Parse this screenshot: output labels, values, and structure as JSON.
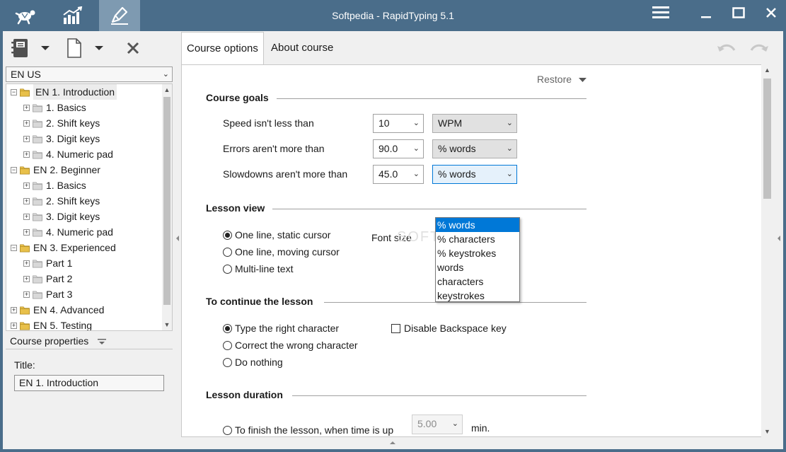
{
  "window": {
    "title": "Softpedia - RapidTyping  5.1"
  },
  "tree": {
    "language": "EN US",
    "items": [
      {
        "label": "EN 1. Introduction",
        "level": 0,
        "exp": "−",
        "selected": true
      },
      {
        "label": "1. Basics",
        "level": 1,
        "exp": "+"
      },
      {
        "label": "2. Shift keys",
        "level": 1,
        "exp": "+"
      },
      {
        "label": "3. Digit keys",
        "level": 1,
        "exp": "+"
      },
      {
        "label": "4. Numeric pad",
        "level": 1,
        "exp": "+"
      },
      {
        "label": "EN 2. Beginner",
        "level": 0,
        "exp": "−"
      },
      {
        "label": "1. Basics",
        "level": 1,
        "exp": "+"
      },
      {
        "label": "2. Shift keys",
        "level": 1,
        "exp": "+"
      },
      {
        "label": "3. Digit keys",
        "level": 1,
        "exp": "+"
      },
      {
        "label": "4. Numeric pad",
        "level": 1,
        "exp": "+"
      },
      {
        "label": "EN 3. Experienced",
        "level": 0,
        "exp": "−"
      },
      {
        "label": "Part 1",
        "level": 1,
        "exp": "+"
      },
      {
        "label": "Part 2",
        "level": 1,
        "exp": "+"
      },
      {
        "label": "Part 3",
        "level": 1,
        "exp": "+"
      },
      {
        "label": "EN 4. Advanced",
        "level": 0,
        "exp": "+"
      },
      {
        "label": "EN 5. Testing",
        "level": 0,
        "exp": "+"
      }
    ]
  },
  "properties": {
    "header": "Course properties",
    "title_label": "Title:",
    "title_value": "EN 1. Introduction"
  },
  "tabs": {
    "course_options": "Course options",
    "about_course": "About course"
  },
  "options": {
    "restore": "Restore",
    "course_goals": {
      "heading": "Course goals",
      "speed_label": "Speed isn't less than",
      "speed_value": "10",
      "speed_unit": "WPM",
      "errors_label": "Errors aren't more than",
      "errors_value": "90.0",
      "errors_unit": "% words",
      "slowdowns_label": "Slowdowns aren't more than",
      "slowdowns_value": "45.0",
      "slowdowns_unit": "% words"
    },
    "unit_options": [
      "% words",
      "% characters",
      "% keystrokes",
      "words",
      "characters",
      "keystrokes"
    ],
    "lesson_view": {
      "heading": "Lesson view",
      "opt1": "One line, static cursor",
      "opt2": "One line, moving cursor",
      "opt3": "Multi-line text",
      "font_size": "Font size"
    },
    "continue_lesson": {
      "heading": "To continue the lesson",
      "opt1": "Type the right character",
      "opt2": "Correct the wrong character",
      "opt3": "Do nothing",
      "disable_backspace": "Disable Backspace key"
    },
    "lesson_duration": {
      "heading": "Lesson duration",
      "finish_label": "To finish the lesson, when time is up",
      "time_value": "5.00",
      "unit": "min."
    }
  },
  "watermark": "SOFTPEDIA",
  "colors": {
    "titlebar": "#4a6d8a",
    "active_tool": "#7e9ab1",
    "highlight": "#0078d7"
  }
}
